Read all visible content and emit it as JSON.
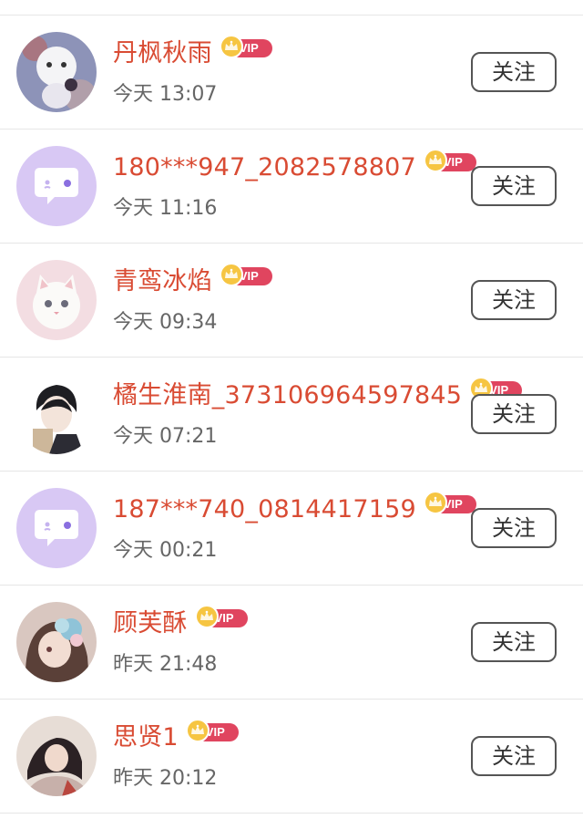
{
  "follow_label": "关注",
  "vip_label": "VIP",
  "colors": {
    "name": "#d94b33",
    "vip_pill": "#e0455f",
    "crown": "#f6c542",
    "time": "#666666",
    "divider": "#e6e6e6"
  },
  "users": [
    {
      "name": "丹枫秋雨",
      "time": "今天 13:07",
      "avatar": "anime-girl-white-cat-avatar"
    },
    {
      "name": "180***947_2082578807",
      "time": "今天 11:16",
      "avatar": "default-chat-bubble-avatar"
    },
    {
      "name": "青鸾冰焰",
      "time": "今天 09:34",
      "avatar": "white-kitten-avatar"
    },
    {
      "name": "橘生淮南_373106964597845",
      "time": "今天 07:21",
      "avatar": "anime-boy-avatar"
    },
    {
      "name": "187***740_0814417159",
      "time": "今天 00:21",
      "avatar": "default-chat-bubble-avatar"
    },
    {
      "name": "顾芙酥",
      "time": "昨天 21:48",
      "avatar": "anime-girl-flowers-avatar"
    },
    {
      "name": "思贤1",
      "time": "昨天 20:12",
      "avatar": "girl-photo-avatar"
    }
  ]
}
